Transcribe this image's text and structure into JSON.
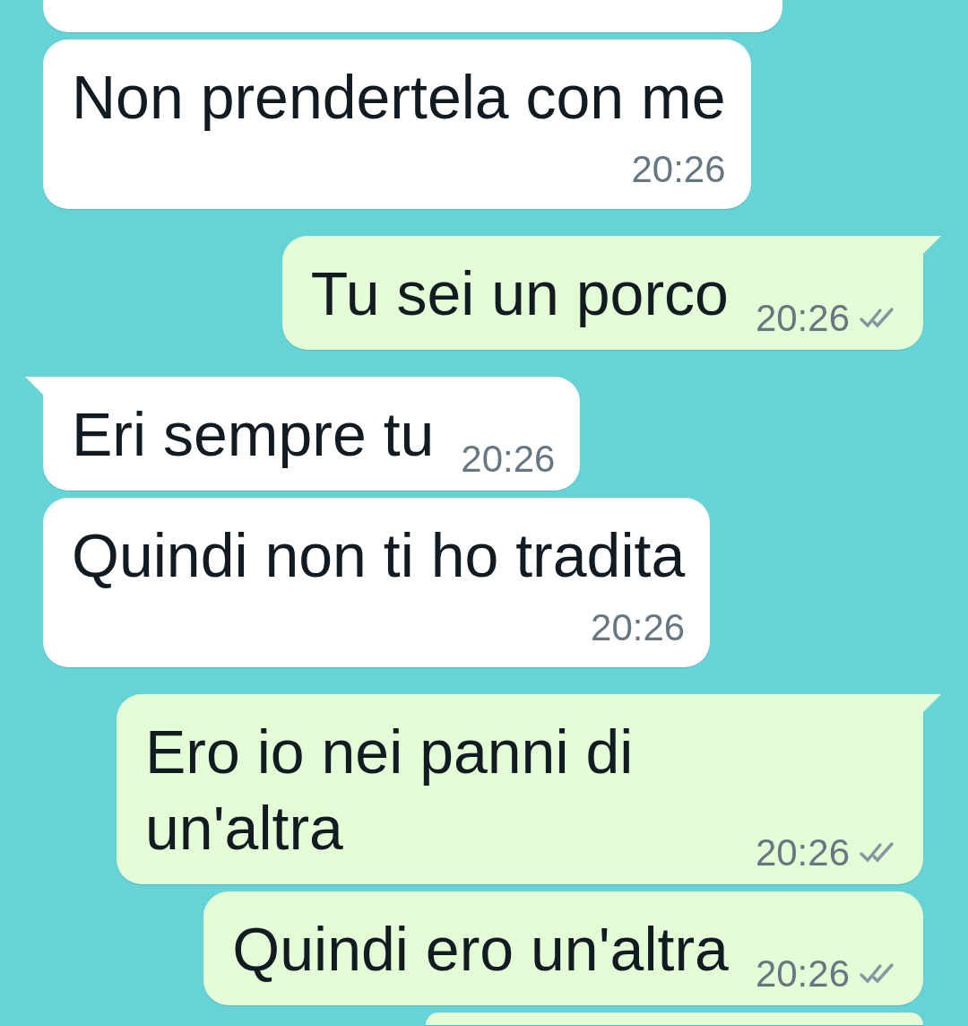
{
  "messages": [
    {
      "outgoing": false,
      "kind": "cut_top"
    },
    {
      "outgoing": false,
      "kind": "stacked",
      "text": "Non prendertela con me",
      "time": "20:26"
    },
    {
      "outgoing": true,
      "kind": "inline",
      "text": "Tu sei un porco",
      "time": "20:26",
      "read": false
    },
    {
      "outgoing": false,
      "kind": "inline",
      "text": "Eri sempre tu",
      "time": "20:26"
    },
    {
      "outgoing": false,
      "kind": "stacked",
      "text": "Quindi non ti ho tradita",
      "time": "20:26"
    },
    {
      "outgoing": true,
      "kind": "inline",
      "text": "Ero io nei panni di un'altra",
      "time": "20:26",
      "read": false
    },
    {
      "outgoing": true,
      "kind": "inline",
      "text": "Quindi ero un'altra",
      "time": "20:26",
      "read": false
    },
    {
      "outgoing": true,
      "kind": "cut_bottom"
    }
  ]
}
